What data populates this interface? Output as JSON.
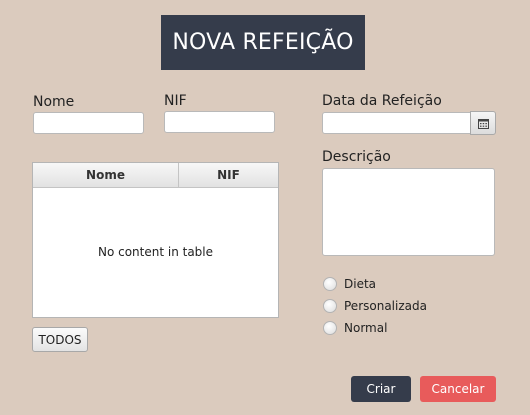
{
  "header": {
    "title": "NOVA REFEIÇÃO"
  },
  "form": {
    "nome_label": "Nome",
    "nome_value": "",
    "nif_label": "NIF",
    "nif_value": "",
    "data_label": "Data da Refeição",
    "data_value": "",
    "descricao_label": "Descrição",
    "descricao_value": ""
  },
  "table": {
    "columns": [
      "Nome",
      "NIF"
    ],
    "rows": [],
    "empty_message": "No content in table"
  },
  "buttons": {
    "todos": "TODOS",
    "criar": "Criar",
    "cancelar": "Cancelar"
  },
  "options": {
    "radios": [
      {
        "label": "Dieta",
        "selected": false
      },
      {
        "label": "Personalizada",
        "selected": false
      },
      {
        "label": "Normal",
        "selected": false
      }
    ]
  },
  "colors": {
    "background": "#dbcbbe",
    "title_bg": "#353c4b",
    "criar_bg": "#353c4b",
    "cancelar_bg": "#e85b5b"
  },
  "icons": {
    "date_picker": "calendar-icon"
  }
}
